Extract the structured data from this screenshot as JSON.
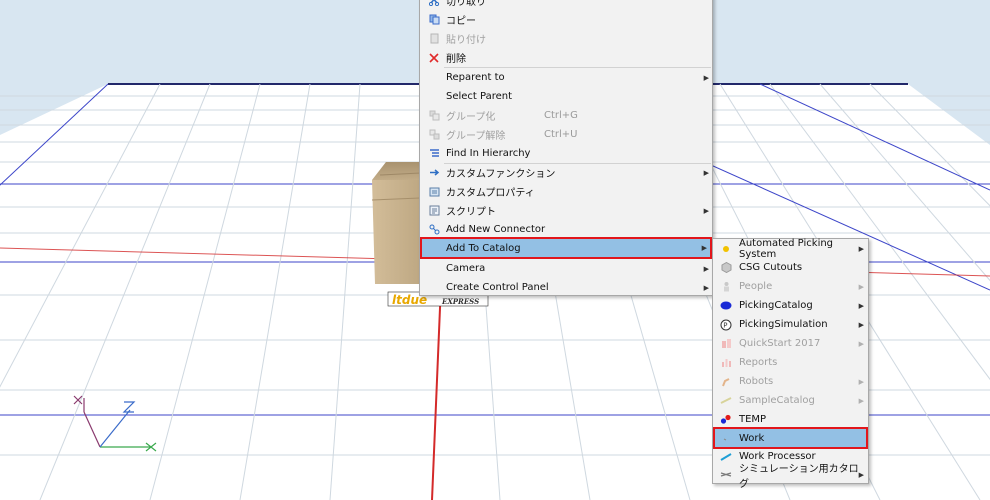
{
  "main_menu": {
    "items": [
      {
        "label": "切り取り",
        "icon": "scissors-icon",
        "disabled": false,
        "shortcut": "",
        "submenu": false
      },
      {
        "label": "コピー",
        "icon": "copy-icon",
        "disabled": false,
        "shortcut": "",
        "submenu": false
      },
      {
        "label": "貼り付け",
        "icon": "paste-icon",
        "disabled": true,
        "shortcut": "",
        "submenu": false
      },
      {
        "label": "削除",
        "icon": "delete-icon",
        "disabled": false,
        "shortcut": "",
        "submenu": false
      },
      {
        "label": "Reparent to",
        "icon": "",
        "disabled": false,
        "shortcut": "",
        "submenu": true
      },
      {
        "label": "Select Parent",
        "icon": "",
        "disabled": false,
        "shortcut": "",
        "submenu": false
      },
      {
        "label": "グループ化",
        "icon": "group-icon",
        "disabled": true,
        "shortcut": "Ctrl+G",
        "submenu": false
      },
      {
        "label": "グループ解除",
        "icon": "ungroup-icon",
        "disabled": true,
        "shortcut": "Ctrl+U",
        "submenu": false
      },
      {
        "label": "Find In Hierarchy",
        "icon": "hierarchy-icon",
        "disabled": false,
        "shortcut": "",
        "submenu": false
      },
      {
        "label": "カスタムファンクション",
        "icon": "arrow-right-icon",
        "disabled": false,
        "shortcut": "",
        "submenu": true
      },
      {
        "label": "カスタムプロパティ",
        "icon": "properties-icon",
        "disabled": false,
        "shortcut": "",
        "submenu": false
      },
      {
        "label": "スクリプト",
        "icon": "script-icon",
        "disabled": false,
        "shortcut": "",
        "submenu": true
      },
      {
        "label": "Add New Connector",
        "icon": "connector-icon",
        "disabled": false,
        "shortcut": "",
        "submenu": false
      },
      {
        "label": "Add To Catalog",
        "icon": "",
        "disabled": false,
        "shortcut": "",
        "submenu": true,
        "highlighted": true
      },
      {
        "label": "Camera",
        "icon": "",
        "disabled": false,
        "shortcut": "",
        "submenu": true
      },
      {
        "label": "Create Control Panel",
        "icon": "",
        "disabled": false,
        "shortcut": "",
        "submenu": true
      }
    ]
  },
  "sub_menu": {
    "items": [
      {
        "label": "Automated Picking System",
        "icon": "yellow-dot-icon",
        "disabled": false,
        "submenu": true
      },
      {
        "label": "CSG Cutouts",
        "icon": "hexagon-icon",
        "disabled": false,
        "submenu": false
      },
      {
        "label": "People",
        "icon": "people-icon",
        "disabled": true,
        "submenu": true
      },
      {
        "label": "PickingCatalog",
        "icon": "blue-blob-icon",
        "disabled": false,
        "submenu": true
      },
      {
        "label": "PickingSimulation",
        "icon": "picking-simulation-icon",
        "disabled": false,
        "submenu": true
      },
      {
        "label": "QuickStart 2017",
        "icon": "quickstart-icon",
        "disabled": true,
        "submenu": true
      },
      {
        "label": "Reports",
        "icon": "reports-icon",
        "disabled": true,
        "submenu": false
      },
      {
        "label": "Robots",
        "icon": "robot-icon",
        "disabled": true,
        "submenu": true
      },
      {
        "label": "SampleCatalog",
        "icon": "sample-catalog-icon",
        "disabled": true,
        "submenu": true
      },
      {
        "label": "TEMP",
        "icon": "temp-dots-icon",
        "disabled": false,
        "submenu": false
      },
      {
        "label": "Work",
        "icon": "work-icon",
        "disabled": false,
        "submenu": false,
        "highlighted": true
      },
      {
        "label": "Work Processor",
        "icon": "work-processor-icon",
        "disabled": false,
        "submenu": false
      },
      {
        "label": "シミュレーション用カタログ",
        "icon": "simulation-catalog-icon",
        "disabled": false,
        "submenu": true
      }
    ]
  },
  "scene": {
    "box_label_logo": "ltdue",
    "box_label_text": "EXPRESS",
    "colors": {
      "floor": "#ffffff",
      "sky": "#d8e6f1",
      "grid_minor": "#c9d3dc",
      "grid_major": "#3d46c9",
      "axis_x": "#d42a2a",
      "highlight": "#93c0e4",
      "callout": "#e2161b"
    }
  }
}
